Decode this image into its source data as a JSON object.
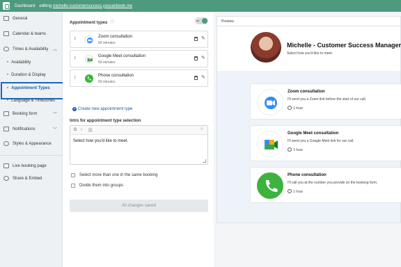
{
  "topbar": {
    "dashboard_label": "Dashboard",
    "editing_prefix": "editing",
    "editing_url": "michelle-customersuccess.youcanbook.me"
  },
  "sidebar": {
    "items": [
      {
        "label": "General"
      },
      {
        "label": "Calendar & teams"
      },
      {
        "label": "Times & Availability"
      },
      {
        "label": "Booking form"
      },
      {
        "label": "Notifications"
      },
      {
        "label": "Styles & Appearance"
      },
      {
        "label": "Live booking page"
      },
      {
        "label": "Share & Embed"
      }
    ],
    "subitems": [
      {
        "label": "Availability"
      },
      {
        "label": "Duration & Display"
      },
      {
        "label": "Appointment Types"
      },
      {
        "label": "Language & Timezones"
      }
    ]
  },
  "appointment_types": {
    "heading": "Appointment types",
    "toggle_label": "on",
    "items": [
      {
        "name": "Zoom consultation",
        "duration": "60 minutes",
        "icon": "zoom-icon",
        "color": "#2d8cff"
      },
      {
        "name": "Google Meet consultation",
        "duration": "60 minutes",
        "icon": "google-meet-icon",
        "color": "#00832d"
      },
      {
        "name": "Phone consultation",
        "duration": "60 minutes",
        "icon": "phone-icon",
        "color": "#3db33d"
      }
    ],
    "create_label": "Create new appointment type"
  },
  "intro": {
    "heading": "Intro for appointment type selection",
    "text": "Select how you'd like to meet."
  },
  "checkboxes": [
    {
      "label": "Select more than one in the same booking"
    },
    {
      "label": "Divide them into groups"
    }
  ],
  "save_label": "All changes saved",
  "preview": {
    "tab_label": "Preview",
    "name": "Michelle - Customer Success Manager",
    "subtitle": "Select how you'd like to meet.",
    "cards": [
      {
        "title": "Zoom consultation",
        "desc": "I'll send you a Zoom link before the start of our call.",
        "length": "1 hour"
      },
      {
        "title": "Google Meet consultation",
        "desc": "I'll send you a Google Meet link for our call.",
        "length": "1 hour"
      },
      {
        "title": "Phone consultation",
        "desc": "I'll call you at the number you provide on the booking form.",
        "length": "1 hour"
      }
    ]
  }
}
